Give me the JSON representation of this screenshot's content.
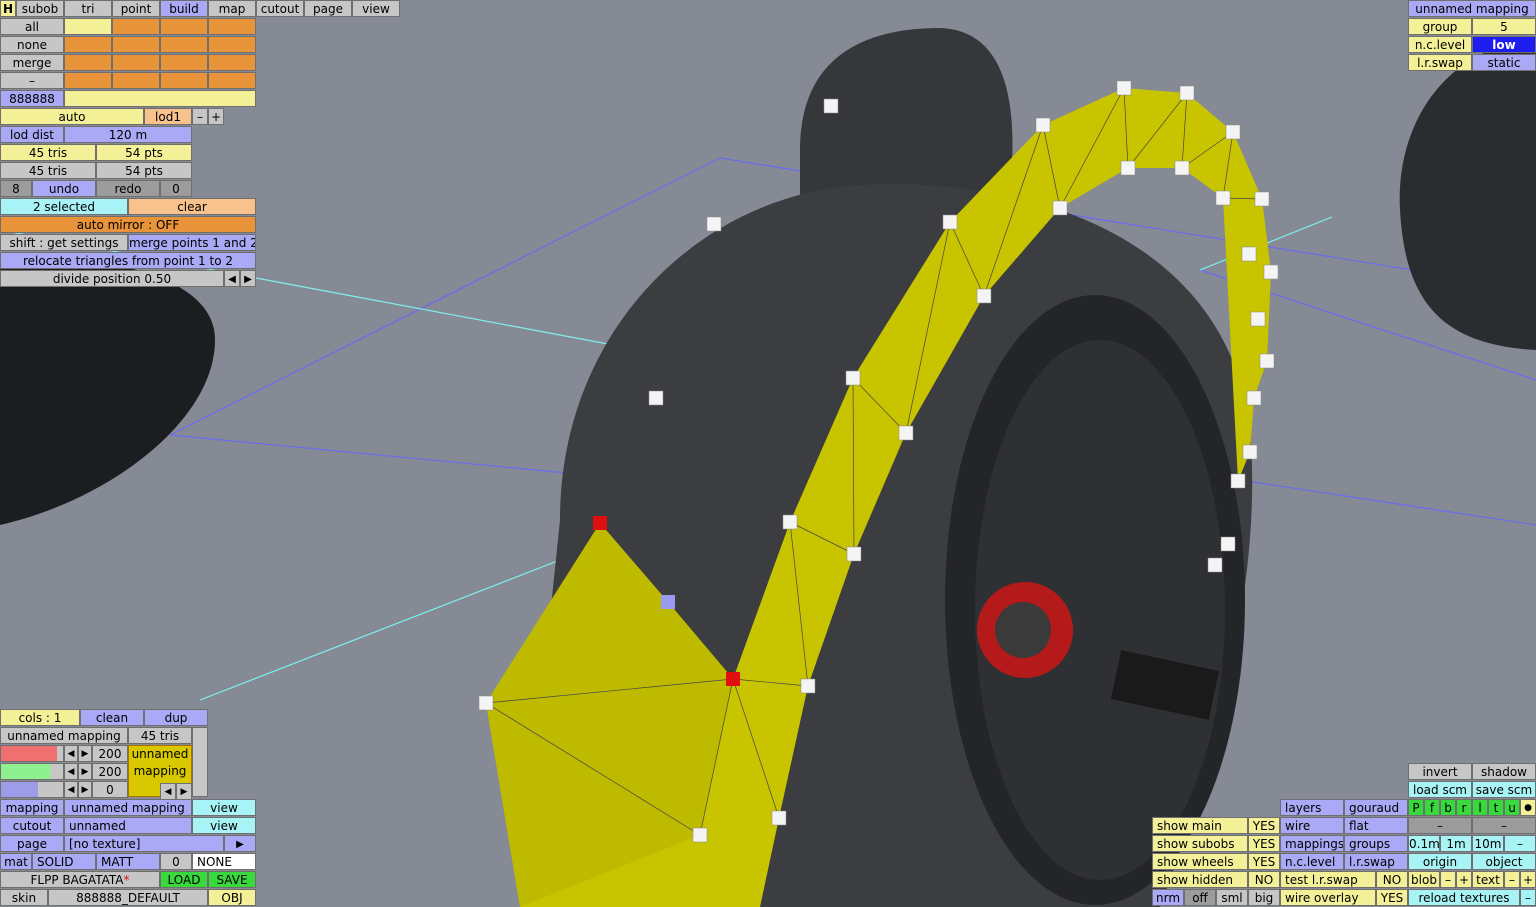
{
  "top_tabs": [
    "H",
    "subob",
    "tri",
    "point",
    "build",
    "map",
    "cutout",
    "page",
    "view"
  ],
  "left_panel": {
    "sel_all": "all",
    "sel_none": "none",
    "sel_merge": "merge",
    "sel_dash": "–",
    "color_code": "888888",
    "auto": "auto",
    "lod": "lod1",
    "minus": "–",
    "plus": "+",
    "lod_dist_label": "lod dist",
    "lod_dist_value": "120 m",
    "tris1": "45 tris",
    "pts1": "54 pts",
    "tris2": "45 tris",
    "pts2": "54 pts",
    "undo_count": "8",
    "undo": "undo",
    "redo": "redo",
    "redo_count": "0",
    "selected": "2 selected",
    "clear": "clear",
    "auto_mirror": "auto mirror : OFF",
    "shift_get": "shift : get settings",
    "merge_points": "merge points 1 and 2",
    "relocate": "relocate triangles from point 1 to 2",
    "divide": "divide position 0.50",
    "arrow_left": "◀",
    "arrow_right": "▶"
  },
  "top_right": {
    "title": "unnamed mapping",
    "group_label": "group",
    "group_value": "5",
    "nclevel_label": "n.c.level",
    "nclevel_value": "low",
    "lrswap_label": "l.r.swap",
    "lrswap_value": "static"
  },
  "bottom_left": {
    "cols": "cols : 1",
    "clean": "clean",
    "dup": "dup",
    "mapping_name": "unnamed mapping",
    "mapping_tris": "45 tris",
    "val1": "200",
    "val2": "200",
    "val3": "0",
    "preview_line1": "unnamed",
    "preview_line2": "mapping",
    "mapping_label": "mapping",
    "mapping_value": "unnamed mapping",
    "view1": "view",
    "cutout_label": "cutout",
    "cutout_value": "unnamed",
    "view2": "view",
    "page_label": "page",
    "page_value": "[no texture]",
    "page_arrow": "▶",
    "mat": "mat",
    "solid": "SOLID",
    "matt": "MATT",
    "mat_num": "0",
    "none": "NONE",
    "car_name": "FLPP BAGATATA",
    "star": "*",
    "load": "LOAD",
    "save": "SAVE",
    "skin": "skin",
    "skin_value": "888888_DEFAULT",
    "obj": "OBJ"
  },
  "bottom_right": {
    "show_main": "show main",
    "show_main_v": "YES",
    "show_subobs": "show subobs",
    "show_subobs_v": "YES",
    "show_wheels": "show wheels",
    "show_wheels_v": "YES",
    "show_hidden": "show hidden",
    "show_hidden_v": "NO",
    "nrm": "nrm",
    "off": "off",
    "sml": "sml",
    "big": "big",
    "layers": "layers",
    "gouraud": "gouraud",
    "wire": "wire",
    "flat": "flat",
    "mappings": "mappings",
    "groups": "groups",
    "nclevel": "n.c.level",
    "lrswap": "l.r.swap",
    "test_lrswap": "test l.r.swap",
    "test_lrswap_v": "NO",
    "wire_overlay": "wire overlay",
    "wire_overlay_v": "YES",
    "invert": "invert",
    "shadow": "shadow",
    "load_scm": "load scm",
    "save_scm": "save scm",
    "letters": [
      "P",
      "f",
      "b",
      "r",
      "l",
      "t",
      "u",
      "●"
    ],
    "dash1": "–",
    "dash2": "–",
    "d01": "0.1m",
    "d1": "1m",
    "d10": "10m",
    "dminus": "–",
    "origin": "origin",
    "object": "object",
    "blob": "blob",
    "blob_minus": "–",
    "blob_plus": "+",
    "text": "text",
    "text_minus": "–",
    "text_plus": "+",
    "reload": "reload textures",
    "reload_minus": "–"
  },
  "colors": {
    "viewport": "#858a94",
    "mesh_yellow": "#c8c400",
    "tyre": "#3a3c40"
  }
}
